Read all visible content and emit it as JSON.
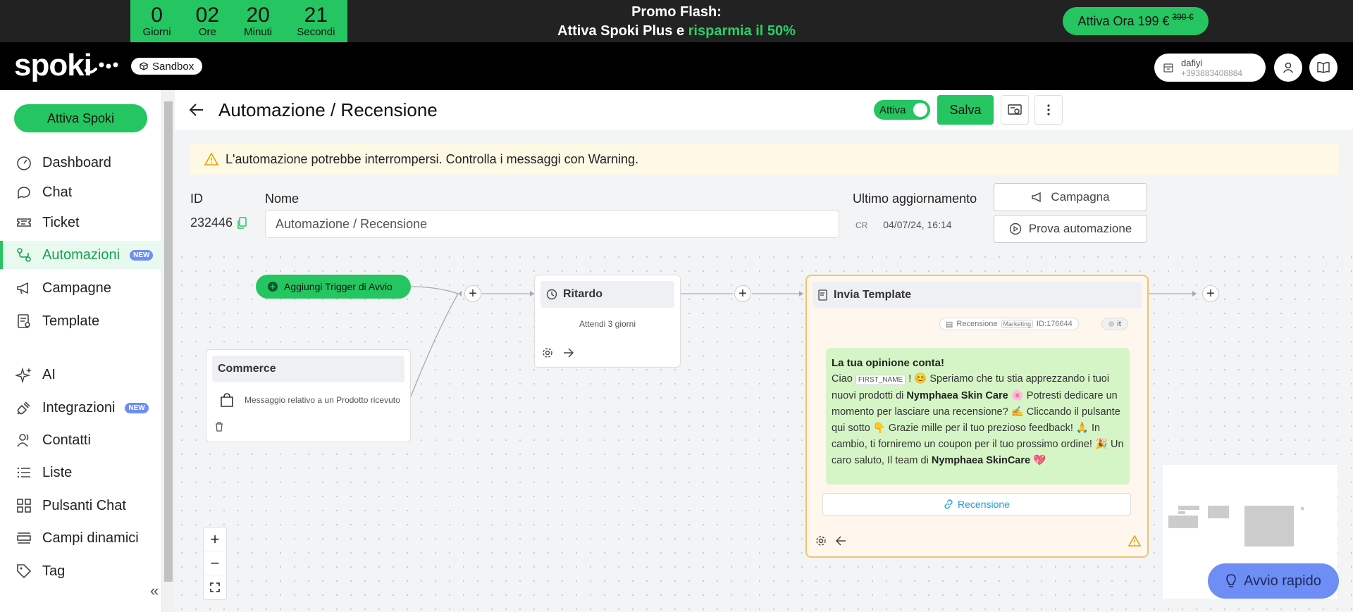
{
  "promo": {
    "countdown": [
      {
        "value": "0",
        "label": "Giorni"
      },
      {
        "value": "02",
        "label": "Ore"
      },
      {
        "value": "20",
        "label": "Minuti"
      },
      {
        "value": "21",
        "label": "Secondi"
      }
    ],
    "title": "Promo Flash:",
    "subtitle_prefix": "Attiva Spoki Plus e ",
    "subtitle_highlight": "risparmia il 50%",
    "button_label": "Attiva Ora 199 €",
    "button_old_price": "399 €",
    "highlight_color": "#25d366"
  },
  "navbar": {
    "logo": "spoki",
    "sandbox_label": "Sandbox",
    "account_name": "dafiyi",
    "account_phone": "+393883408884"
  },
  "sidebar": {
    "cta_label": "Attiva Spoki",
    "items": [
      {
        "label": "Dashboard",
        "icon": "dashboard-icon"
      },
      {
        "label": "Chat",
        "icon": "chat-icon"
      },
      {
        "label": "Ticket",
        "icon": "ticket-icon"
      },
      {
        "label": "Automazioni",
        "icon": "automation-icon",
        "badge": "NEW",
        "active": true
      },
      {
        "label": "Campagne",
        "icon": "megaphone-icon"
      },
      {
        "label": "Template",
        "icon": "template-icon"
      },
      {
        "label": "AI",
        "icon": "sparkle-icon"
      },
      {
        "label": "Integrazioni",
        "icon": "plug-icon",
        "badge": "NEW"
      },
      {
        "label": "Contatti",
        "icon": "contacts-icon"
      },
      {
        "label": "Liste",
        "icon": "list-icon"
      },
      {
        "label": "Pulsanti Chat",
        "icon": "widgets-icon"
      },
      {
        "label": "Campi dinamici",
        "icon": "fields-icon"
      },
      {
        "label": "Tag",
        "icon": "tag-icon"
      }
    ]
  },
  "header": {
    "title": "Automazione / Recensione",
    "toggle_label": "Attiva",
    "save_label": "Salva"
  },
  "warning": {
    "text": "L'automazione potrebbe interrompersi. Controlla i messaggi con Warning."
  },
  "form": {
    "id_label": "ID",
    "id_value": "232446",
    "name_label": "Nome",
    "name_value": "Automazione / Recensione",
    "updated_label": "Ultimo aggiornamento",
    "updated_prefix": "CR",
    "updated_value": "04/07/24, 16:14",
    "campaign_button": "Campagna",
    "test_button": "Prova automazione"
  },
  "flow": {
    "trigger_button": "Aggiungi Trigger di Avvio",
    "commerce_node": {
      "title": "Commerce",
      "text": "Messaggio relativo a un Prodotto ricevuto"
    },
    "delay_node": {
      "title": "Ritardo",
      "text": "Attendi 3 giorni"
    },
    "template_node": {
      "title": "Invia Template",
      "template_name": "Recensione",
      "category": "Marketing",
      "template_id": "ID:176644",
      "language": "it",
      "message_title": "La tua opinione conta!",
      "message": {
        "p1": "Ciao ",
        "var": "FIRST_NAME",
        "p2": " ! 😊 Speriamo che tu stia apprezzando i tuoi nuovi prodotti di ",
        "brand1": "Nymphaea Skin Care",
        "p3": " 🌸 Potresti dedicare un momento per lasciare una recensione? ✍️ Cliccando il pulsante qui sotto 👇 Grazie mille per il tuo prezioso feedback! 🙏 In cambio, ti forniremo un coupon per il tuo prossimo ordine! 🎉 Un caro saluto, Il team di ",
        "brand2": "Nymphaea SkinCare",
        "p4": " 💖"
      },
      "button_label": "Recensione"
    }
  },
  "quick_start_label": "Avvio rapido",
  "colors": {
    "brand_green": "#25c561",
    "warning_bg": "#fef9e5",
    "badge_blue": "#6e8ef5"
  }
}
